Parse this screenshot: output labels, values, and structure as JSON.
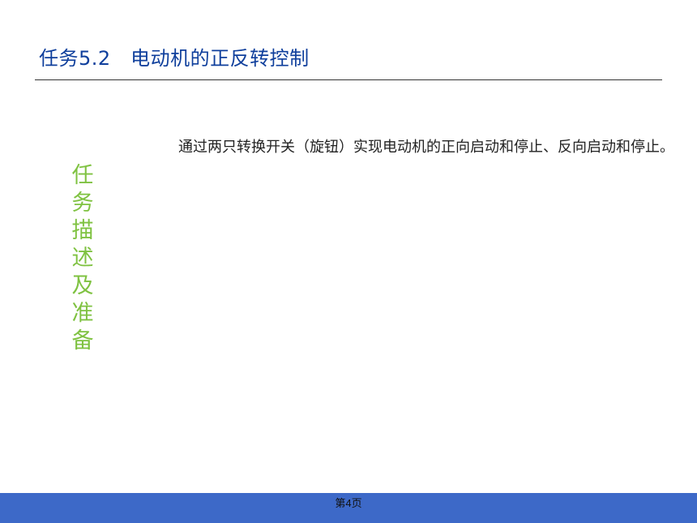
{
  "slide": {
    "title": "任务5.2　电动机的正反转控制",
    "side_label": "任务描述及准备",
    "body_text": "通过两只转换开关（旋钮）实现电动机的正向启动和停止、反向启动和停止。",
    "page_number": "第4页"
  },
  "colors": {
    "title": "#0f3f9c",
    "side_label": "#7fc241",
    "footer_bar": "#3d69c8"
  }
}
